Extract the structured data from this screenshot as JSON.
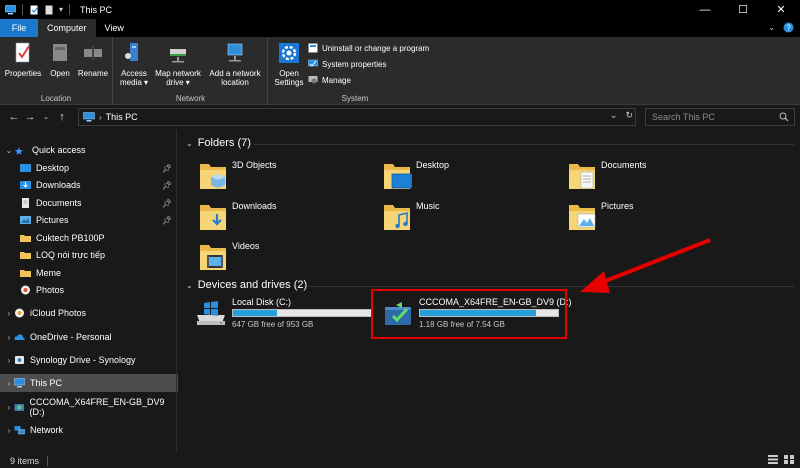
{
  "window": {
    "title": "This PC",
    "minimize": "—",
    "maximize": "☐",
    "close": "✕"
  },
  "ribbon_tabs": [
    "File",
    "Computer",
    "View"
  ],
  "ribbon": {
    "location": {
      "label": "Location",
      "buttons": [
        "Properties",
        "Open",
        "Rename"
      ]
    },
    "network": {
      "label": "Network",
      "access_media": [
        "Access",
        "media ▾"
      ],
      "map_drive": [
        "Map network",
        "drive ▾"
      ],
      "add_location": [
        "Add a network",
        "location"
      ]
    },
    "system": {
      "label": "System",
      "open_settings": [
        "Open",
        "Settings"
      ],
      "uninstall": "Uninstall or change a program",
      "system_properties": "System properties",
      "manage": "Manage"
    }
  },
  "address": {
    "path": "This PC",
    "search_placeholder": "Search This PC"
  },
  "sidebar": {
    "quick_access": "Quick access",
    "items": [
      {
        "label": "Desktop",
        "pinned": true
      },
      {
        "label": "Downloads",
        "pinned": true
      },
      {
        "label": "Documents",
        "pinned": true
      },
      {
        "label": "Pictures",
        "pinned": true
      },
      {
        "label": "Cuktech PB100P",
        "pinned": false
      },
      {
        "label": "LOQ nói trực tiếp",
        "pinned": false
      },
      {
        "label": "Meme",
        "pinned": false
      },
      {
        "label": "Photos",
        "pinned": false
      }
    ],
    "icloud": "iCloud Photos",
    "onedrive": "OneDrive - Personal",
    "synology": "Synology Drive - Synology",
    "this_pc": "This PC",
    "dvd": "CCCOMA_X64FRE_EN-GB_DV9 (D:)",
    "network": "Network"
  },
  "main": {
    "folders_header": "Folders (7)",
    "folders": [
      "3D Objects",
      "Desktop",
      "Documents",
      "Downloads",
      "Music",
      "Pictures",
      "Videos"
    ],
    "drives_header": "Devices and drives (2)",
    "drives": [
      {
        "name": "Local Disk (C:)",
        "free": "647 GB free of 953 GB",
        "used_fraction": 0.32
      },
      {
        "name": "CCCOMA_X64FRE_EN-GB_DV9 (D:)",
        "free": "1.18 GB free of 7.54 GB",
        "used_fraction": 0.84
      }
    ]
  },
  "status": {
    "items_count": "9 items"
  },
  "colors": {
    "accent": "#1979ca",
    "drive_fill": "#26a0da",
    "highlight": "#e60000"
  }
}
